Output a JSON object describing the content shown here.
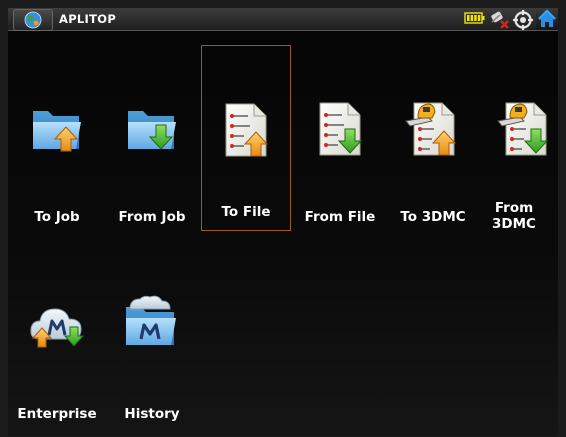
{
  "app": {
    "title": "APLITOP"
  },
  "status_icons": [
    "battery-icon",
    "satellite-disconnected-icon",
    "gps-target-icon"
  ],
  "colors": {
    "selection_border": "#9a5b14",
    "folder_blue": "#5fb0e8",
    "arrow_orange": "#f0a020",
    "arrow_green": "#4fb030"
  },
  "tiles": [
    {
      "label": "To Job",
      "icon": "folder-export-icon",
      "selected": false
    },
    {
      "label": "From Job",
      "icon": "folder-import-icon",
      "selected": false
    },
    {
      "label": "To File",
      "icon": "file-export-icon",
      "selected": true
    },
    {
      "label": "From File",
      "icon": "file-import-icon",
      "selected": false
    },
    {
      "label": "To 3DMC",
      "icon": "machine-control-export-icon",
      "selected": false
    },
    {
      "label": "From 3DMC",
      "icon": "machine-control-import-icon",
      "selected": false
    },
    {
      "label": "Enterprise",
      "icon": "enterprise-cloud-icon",
      "selected": false
    },
    {
      "label": "History",
      "icon": "history-folder-icon",
      "selected": false
    }
  ]
}
